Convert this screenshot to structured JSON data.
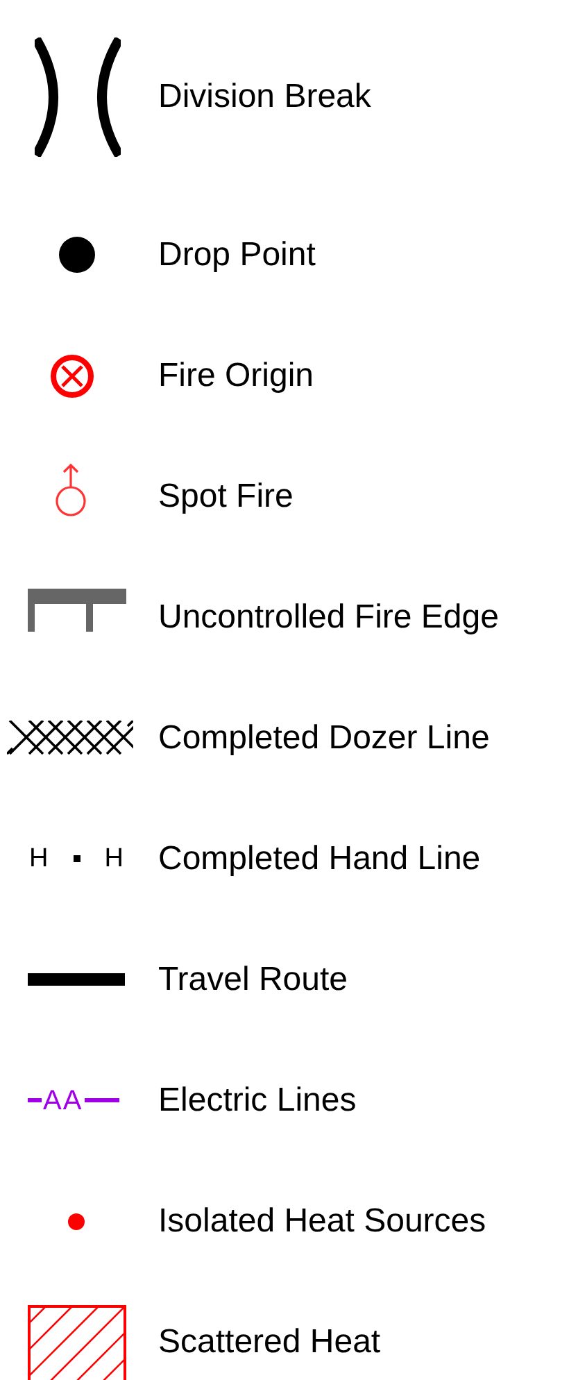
{
  "legend": [
    {
      "label": "Division Break",
      "kind": "division-break"
    },
    {
      "label": "Drop Point",
      "kind": "drop-point"
    },
    {
      "label": "Fire Origin",
      "kind": "fire-origin"
    },
    {
      "label": "Spot Fire",
      "kind": "spot-fire"
    },
    {
      "label": "Uncontrolled Fire Edge",
      "kind": "uncontrolled-edge"
    },
    {
      "label": "Completed Dozer Line",
      "kind": "dozer-line"
    },
    {
      "label": "Completed Hand Line",
      "kind": "hand-line",
      "symbol_text": [
        "H",
        "H"
      ]
    },
    {
      "label": "Travel Route",
      "kind": "travel-route"
    },
    {
      "label": "Electric Lines",
      "kind": "electric-line",
      "symbol_text": [
        "A",
        "A"
      ]
    },
    {
      "label": "Isolated Heat Sources",
      "kind": "heat-dot"
    },
    {
      "label": "Scattered Heat",
      "kind": "hatch"
    }
  ]
}
